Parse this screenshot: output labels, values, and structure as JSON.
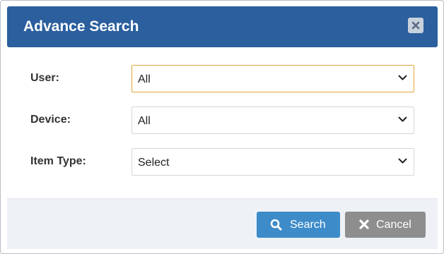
{
  "dialog": {
    "title": "Advance Search",
    "close_icon": "close-icon"
  },
  "form": {
    "user": {
      "label": "User:",
      "value": "All"
    },
    "device": {
      "label": "Device:",
      "value": "All"
    },
    "item_type": {
      "label": "Item Type:",
      "value": "Select"
    }
  },
  "footer": {
    "search_label": "Search",
    "search_icon": "search-icon",
    "cancel_label": "Cancel",
    "cancel_icon": "close-icon"
  },
  "colors": {
    "header_bg": "#2b5f9e",
    "search_button": "#3d8bc9",
    "cancel_button": "#8e8e8e",
    "focus_border": "#e0a53a",
    "footer_bg": "#eef2f7"
  }
}
